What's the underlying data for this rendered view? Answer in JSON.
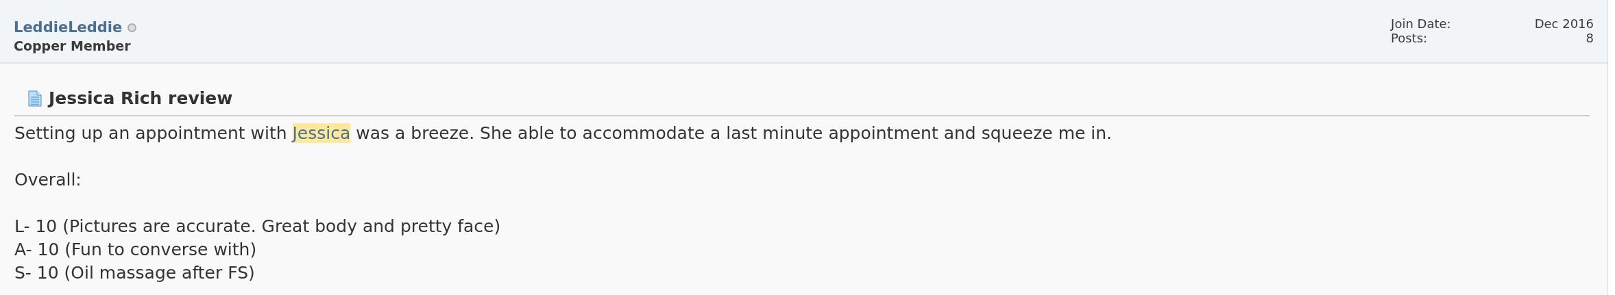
{
  "user": {
    "name": "LeddieLeddie",
    "online": false,
    "rank": "Copper Member"
  },
  "stats": [
    {
      "label": "Join Date:",
      "value": "Dec 2016"
    },
    {
      "label": "Posts:",
      "value": "8"
    }
  ],
  "post": {
    "title": "Jessica Rich review",
    "paragraphs": [
      [
        [
          {
            "text": "Setting up an appointment with ",
            "highlighted": false
          },
          {
            "text": "Jessica",
            "highlighted": true
          },
          {
            "text": " was a breeze. She able to accommodate a last minute appointment and squeeze me in.",
            "highlighted": false
          }
        ]
      ],
      [
        [
          {
            "text": "Overall:",
            "highlighted": false
          }
        ]
      ],
      [
        [
          {
            "text": "L- 10 (Pictures are accurate. Great body and pretty face)",
            "highlighted": false
          }
        ],
        [
          {
            "text": "A- 10 (Fun to converse with)",
            "highlighted": false
          }
        ],
        [
          {
            "text": "S- 10 (Oil massage after FS)",
            "highlighted": false
          }
        ]
      ]
    ]
  }
}
